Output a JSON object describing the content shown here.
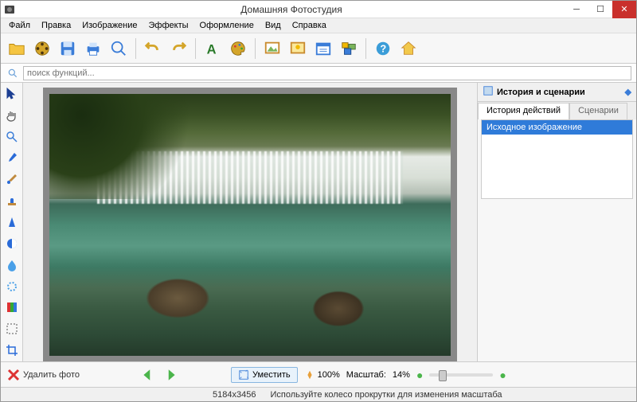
{
  "window": {
    "title": "Домашняя Фотостудия"
  },
  "menu": {
    "file": "Файл",
    "edit": "Правка",
    "image": "Изображение",
    "effects": "Эффекты",
    "design": "Оформление",
    "view": "Вид",
    "help": "Справка"
  },
  "search": {
    "placeholder": "поиск функций..."
  },
  "right_panel": {
    "title": "История и сценарии",
    "tab_history": "История действий",
    "tab_scenarios": "Сценарии",
    "items": [
      "Исходное изображение"
    ]
  },
  "bottom": {
    "delete_photo": "Удалить фото",
    "fit": "Уместить",
    "hundred_percent": "100%",
    "scale_label": "Масштаб:",
    "scale_value": "14%"
  },
  "status": {
    "dimensions": "5184x3456",
    "hint": "Используйте колесо прокрутки для изменения масштаба"
  }
}
